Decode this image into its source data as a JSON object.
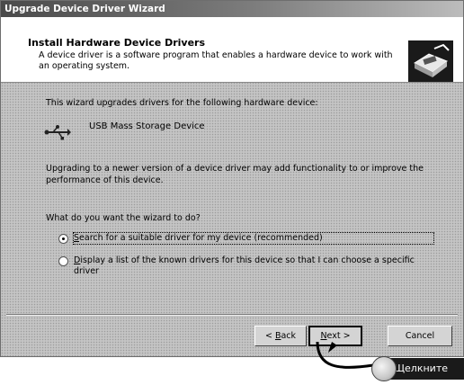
{
  "window": {
    "title": "Upgrade Device Driver Wizard"
  },
  "header": {
    "title": "Install Hardware Device Drivers",
    "description": "A device driver is a software program that enables a hardware device to work with an operating system.",
    "icon": "hardware-device-icon"
  },
  "body": {
    "intro": "This wizard upgrades drivers for the following hardware device:",
    "device_icon": "usb-icon",
    "device_name": "USB Mass Storage Device",
    "upgrade_text": "Upgrading to a newer version of a device driver may add functionality to or improve the performance of this device.",
    "question": "What do you want the wizard to do?",
    "options": [
      {
        "mnemonic": "S",
        "rest": "earch for a suitable driver for my device (recommended)",
        "checked": true
      },
      {
        "mnemonic": "D",
        "rest": "isplay a list of the known drivers for this device so that I can choose a specific driver",
        "checked": false
      }
    ]
  },
  "buttons": {
    "back_prefix": "< ",
    "back_mnemonic": "B",
    "back_rest": "ack",
    "next_mnemonic": "N",
    "next_rest": "ext >",
    "cancel": "Cancel"
  },
  "hint": {
    "label": "Щелкните"
  }
}
